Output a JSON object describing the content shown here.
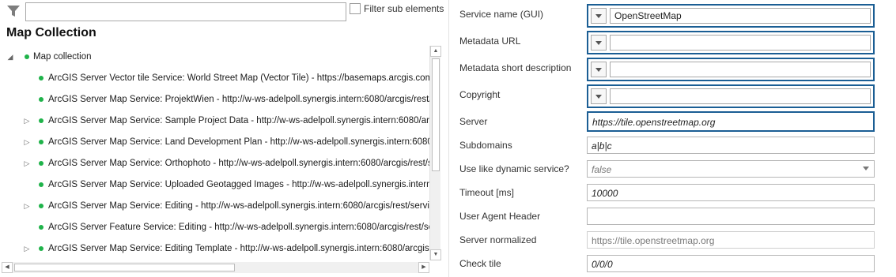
{
  "filter": {
    "icon": "filter-icon",
    "value": "",
    "checkbox_label": "Filter sub elements",
    "checkbox_checked": false
  },
  "panel": {
    "title": "Map Collection"
  },
  "tree": {
    "root": {
      "label": "Map collection",
      "expanded": true
    },
    "items": [
      {
        "label": "ArcGIS Server Vector tile Service: World Street Map (Vector Tile) - https://basemaps.arcgis.com/arcgis/rest/services/World_Basemap_v2/VectorTileServer",
        "expandable": false
      },
      {
        "label": "ArcGIS Server Map Service: ProjektWien - http://w-ws-adelpoll.synergis.intern:6080/arcgis/rest/services/ProjektWien/MapServer",
        "expandable": false
      },
      {
        "label": "ArcGIS Server Map Service: Sample Project Data - http://w-ws-adelpoll.synergis.intern:6080/arcgis/rest/services/SampleProjectData/MapServer",
        "expandable": true
      },
      {
        "label": "ArcGIS Server Map Service: Land Development Plan - http://w-ws-adelpoll.synergis.intern:6080/arcgis/rest/services/LandDevelopmentPlan/MapServer",
        "expandable": true
      },
      {
        "label": "ArcGIS Server Map Service: Orthophoto - http://w-ws-adelpoll.synergis.intern:6080/arcgis/rest/services/Orthophoto/MapServer",
        "expandable": true
      },
      {
        "label": "ArcGIS Server Map Service: Uploaded Geotagged Images - http://w-ws-adelpoll.synergis.intern:6080/arcgis/rest/services/UploadedGeotaggedImages/MapServer",
        "expandable": false
      },
      {
        "label": "ArcGIS Server Map Service: Editing - http://w-ws-adelpoll.synergis.intern:6080/arcgis/rest/services/Editing/MapServer",
        "expandable": true
      },
      {
        "label": "ArcGIS Server Feature Service: Editing - http://w-ws-adelpoll.synergis.intern:6080/arcgis/rest/services/Editing/FeatureServer",
        "expandable": false
      },
      {
        "label": "ArcGIS Server Map Service: Editing Template - http://w-ws-adelpoll.synergis.intern:6080/arcgis/rest/services/EditingTemplate/MapServer",
        "expandable": true
      }
    ]
  },
  "colors": {
    "status_dot": "#1fb34a",
    "focus_border": "#1b5e94"
  },
  "properties": {
    "service_name": {
      "label": "Service name (GUI)",
      "value": "OpenStreetMap"
    },
    "metadata_url": {
      "label": "Metadata URL",
      "value": ""
    },
    "metadata_short": {
      "label": "Metadata short description",
      "value": ""
    },
    "copyright": {
      "label": "Copyright",
      "value": ""
    },
    "server": {
      "label": "Server",
      "value": "https://tile.openstreetmap.org"
    },
    "subdomains": {
      "label": "Subdomains",
      "value": "a|b|c"
    },
    "dynamic": {
      "label": "Use like dynamic service?",
      "value": "false"
    },
    "timeout": {
      "label": "Timeout [ms]",
      "value": "10000"
    },
    "user_agent": {
      "label": "User Agent Header",
      "value": ""
    },
    "server_normalized": {
      "label": "Server normalized",
      "value": "https://tile.openstreetmap.org"
    },
    "check_tile": {
      "label": "Check tile",
      "value": "0/0/0"
    }
  }
}
